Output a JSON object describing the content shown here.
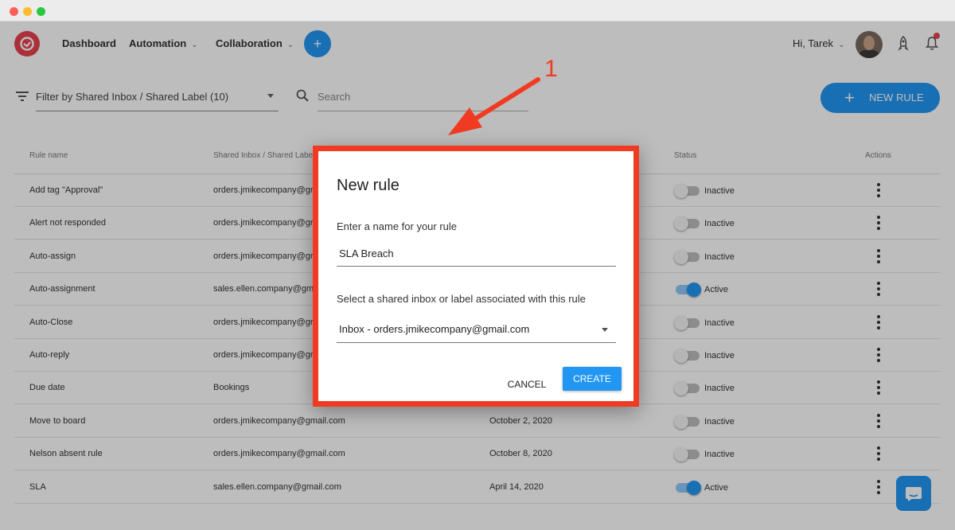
{
  "nav": {
    "links": [
      "Dashboard",
      "Automation",
      "Collaboration"
    ],
    "greeting": "Hi, Tarek",
    "plus_icon": "+"
  },
  "filter": {
    "select_value": "Filter by Shared Inbox / Shared Label (10)",
    "search_placeholder": "Search"
  },
  "new_rule_button": "NEW RULE",
  "table": {
    "headers": [
      "Rule name",
      "Shared Inbox / Shared Label",
      "Status",
      "Actions"
    ],
    "rows": [
      {
        "name": "Add tag \"Approval\"",
        "inbox": "orders.jmikecompany@gr",
        "date": "",
        "status": "Inactive",
        "active": false
      },
      {
        "name": "Alert not responded",
        "inbox": "orders.jmikecompany@gr",
        "date": "",
        "status": "Inactive",
        "active": false
      },
      {
        "name": "Auto-assign",
        "inbox": "orders.jmikecompany@gr",
        "date": "",
        "status": "Inactive",
        "active": false
      },
      {
        "name": "Auto-assignment",
        "inbox": "sales.ellen.company@gm",
        "date": "",
        "status": "Active",
        "active": true
      },
      {
        "name": "Auto-Close",
        "inbox": "orders.jmikecompany@gr",
        "date": "",
        "status": "Inactive",
        "active": false
      },
      {
        "name": "Auto-reply",
        "inbox": "orders.jmikecompany@gr",
        "date": "",
        "status": "Inactive",
        "active": false
      },
      {
        "name": "Due date",
        "inbox": "Bookings",
        "date": "",
        "status": "Inactive",
        "active": false
      },
      {
        "name": "Move to board",
        "inbox": "orders.jmikecompany@gmail.com",
        "date": "October 2, 2020",
        "status": "Inactive",
        "active": false
      },
      {
        "name": "Nelson absent rule",
        "inbox": "orders.jmikecompany@gmail.com",
        "date": "October 8, 2020",
        "status": "Inactive",
        "active": false
      },
      {
        "name": "SLA",
        "inbox": "sales.ellen.company@gmail.com",
        "date": "April 14, 2020",
        "status": "Active",
        "active": true
      }
    ]
  },
  "annotation": {
    "number": "1"
  },
  "dialog": {
    "title": "New rule",
    "name_label": "Enter a name for your rule",
    "name_value": "SLA Breach",
    "inbox_label": "Select a shared inbox or label associated with this rule",
    "inbox_value": "Inbox - orders.jmikecompany@gmail.com",
    "cancel_label": "CANCEL",
    "create_label": "CREATE"
  },
  "colors": {
    "accent": "#2196f3",
    "brand": "#e8414d",
    "annotation": "#f03b22"
  }
}
